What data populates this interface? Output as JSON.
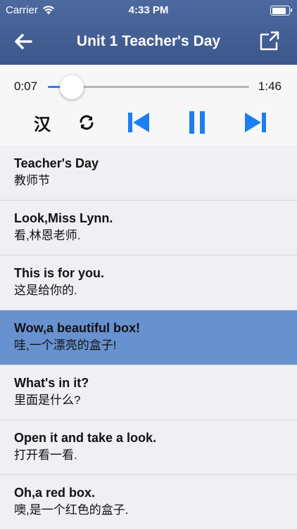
{
  "status_bar": {
    "carrier": "Carrier",
    "time": "4:33 PM",
    "battery_level": 0.9
  },
  "nav": {
    "title": "Unit 1 Teacher's Day"
  },
  "player": {
    "current_time": "0:07",
    "total_time": "1:46",
    "progress": 0.12,
    "lang_toggle": "汉"
  },
  "colors": {
    "header": "#4a66a0",
    "accent": "#2e7cf6",
    "highlight": "#6891cf"
  },
  "sentences": [
    {
      "en": "Teacher's Day",
      "zh": "教师节"
    },
    {
      "en": "Look,Miss Lynn.",
      "zh": "看,林恩老师."
    },
    {
      "en": "This is for you.",
      "zh": "这是给你的."
    },
    {
      "en": "Wow,a beautiful box!",
      "zh": "哇,一个漂亮的盒子!",
      "active": true
    },
    {
      "en": "What's in it?",
      "zh": "里面是什么?"
    },
    {
      "en": "Open it and take a look.",
      "zh": "打开看一看."
    },
    {
      "en": "Oh,a red box.",
      "zh": "噢,是一个红色的盒子."
    }
  ]
}
